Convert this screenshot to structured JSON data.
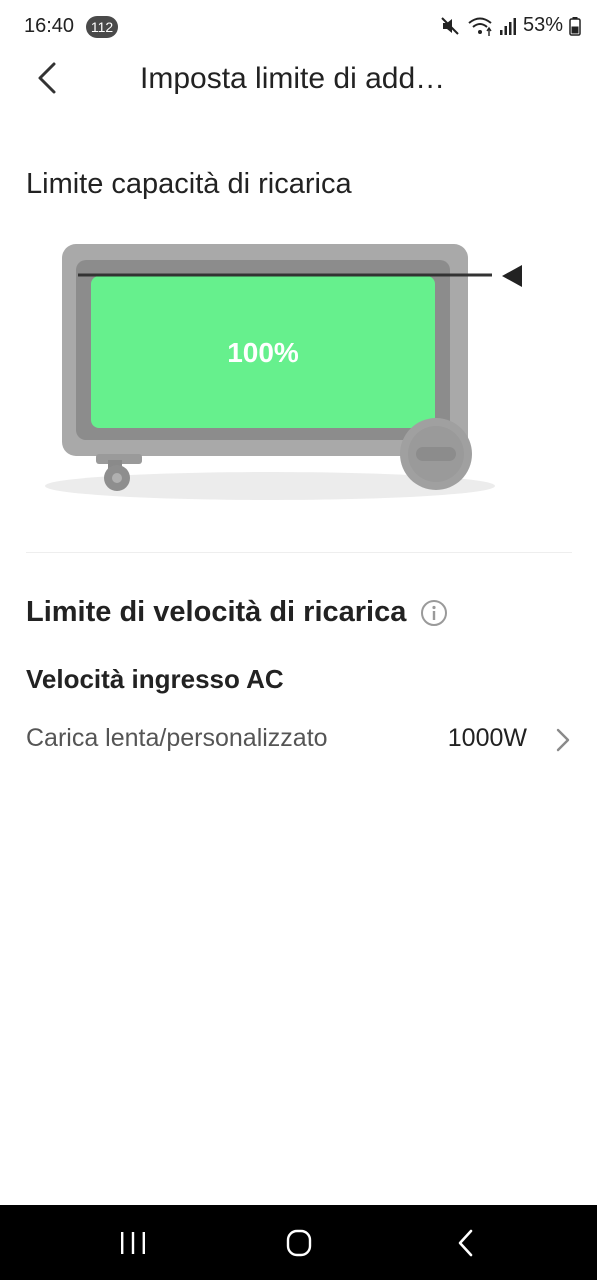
{
  "status_bar": {
    "time": "16:40",
    "badge": "112",
    "battery_percent": "53%",
    "icons": [
      "mute-icon",
      "wifi-icon",
      "signal-icon",
      "battery-icon"
    ]
  },
  "app_bar": {
    "title": "Imposta limite di add…",
    "back_icon": "chevron-left-icon"
  },
  "capacity": {
    "title": "Limite capacità di ricarica",
    "level_percent": 100,
    "level_label": "100%",
    "fill_color": "#66f08d"
  },
  "speed": {
    "title": "Limite di velocità di ricarica",
    "info_icon": "info-icon",
    "ac_heading": "Velocità ingresso AC",
    "ac_row": {
      "label": "Carica lenta/personalizzato",
      "value": "1000W",
      "chevron_icon": "chevron-right-icon"
    }
  },
  "nav_bar": {
    "buttons": [
      "recents-icon",
      "home-icon",
      "back-icon"
    ]
  }
}
